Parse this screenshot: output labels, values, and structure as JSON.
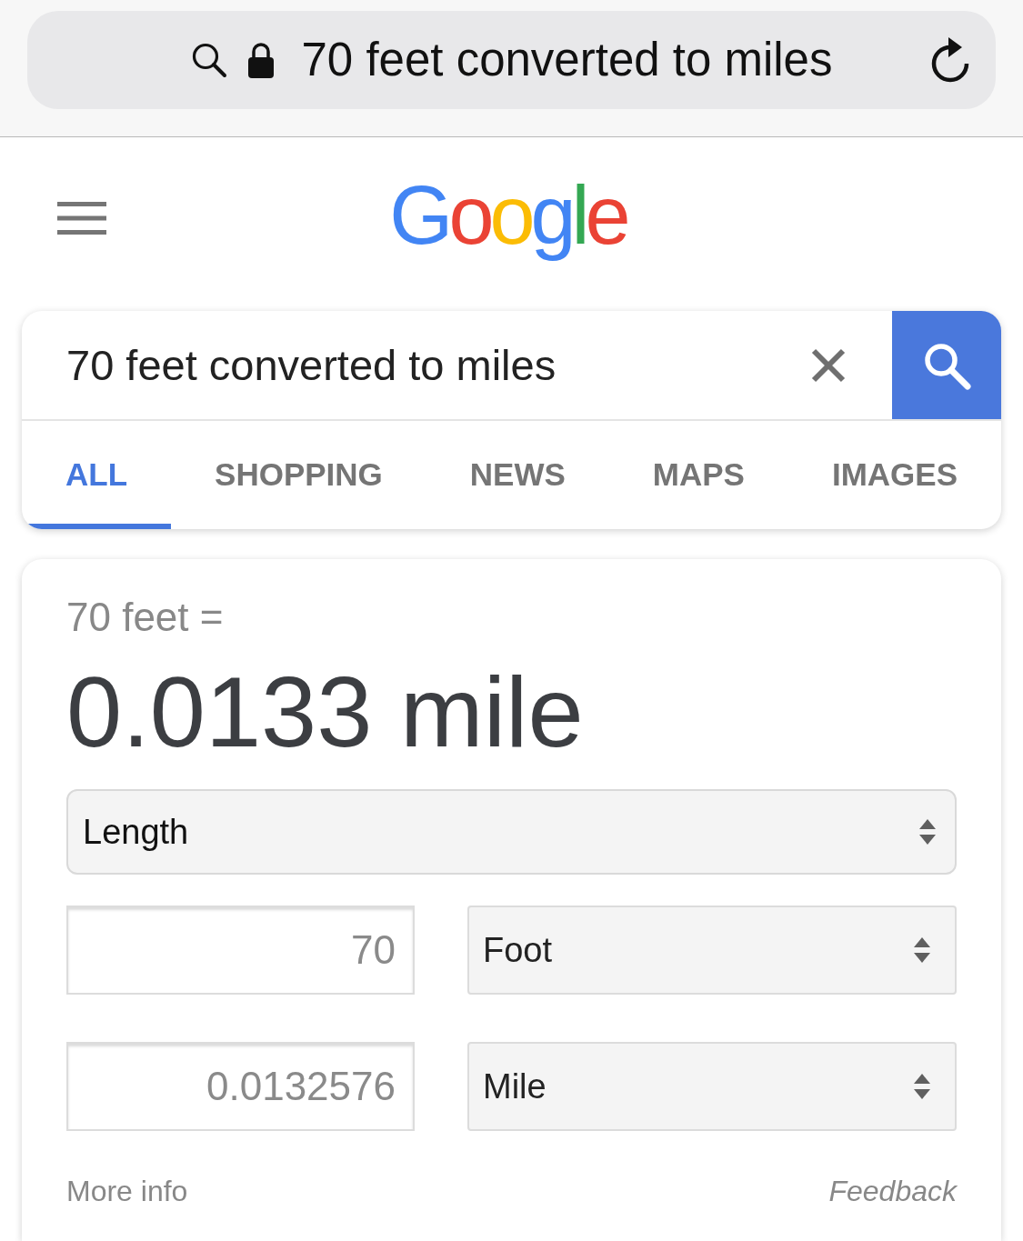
{
  "browser_bar": {
    "secure": true,
    "address": "70 feet converted to miles"
  },
  "header": {
    "logo": "Google"
  },
  "search": {
    "query": "70 feet converted to miles"
  },
  "tabs": [
    {
      "label": "ALL",
      "selected": true
    },
    {
      "label": "SHOPPING",
      "selected": false
    },
    {
      "label": "NEWS",
      "selected": false
    },
    {
      "label": "MAPS",
      "selected": false
    },
    {
      "label": "IMAGES",
      "selected": false
    }
  ],
  "converter": {
    "input_label": "70 feet =",
    "result": "0.0133 mile",
    "category": "Length",
    "rows": [
      {
        "value": "70",
        "unit": "Foot"
      },
      {
        "value": "0.0132576",
        "unit": "Mile"
      }
    ],
    "more_info": "More info",
    "feedback": "Feedback"
  }
}
